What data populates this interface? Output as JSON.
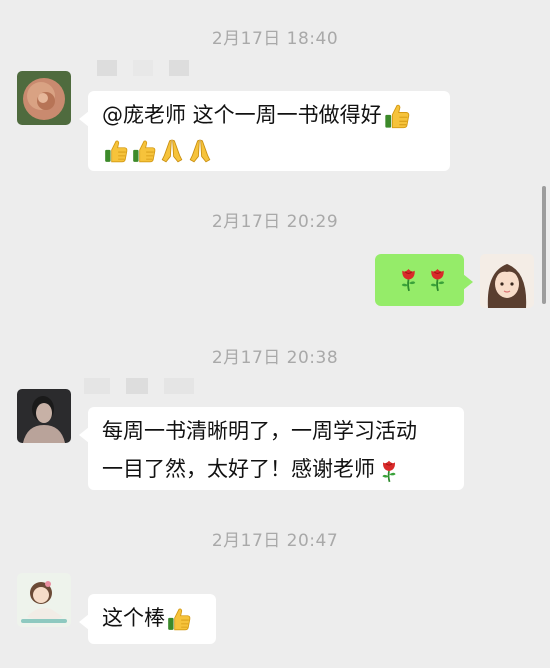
{
  "timestamps": [
    "2月17日 18:40",
    "2月17日 20:29",
    "2月17日 20:38",
    "2月17日 20:47"
  ],
  "messages": [
    {
      "text_line1": "@庞老师 这个一周一书做得好"
    },
    {
      "text": ""
    },
    {
      "text_line1": "每周一书清晰明了，一周学习活动",
      "text_line2": "一目了然，太好了！感谢老师"
    },
    {
      "text": "这个棒"
    }
  ],
  "icons": {
    "thumbs_up": "thumbs-up-icon",
    "pray": "pray-hands-icon",
    "rose": "rose-icon"
  },
  "colors": {
    "background": "#ededed",
    "bubble_incoming": "#ffffff",
    "bubble_outgoing": "#95ec69",
    "timestamp": "#a9a9a9"
  }
}
